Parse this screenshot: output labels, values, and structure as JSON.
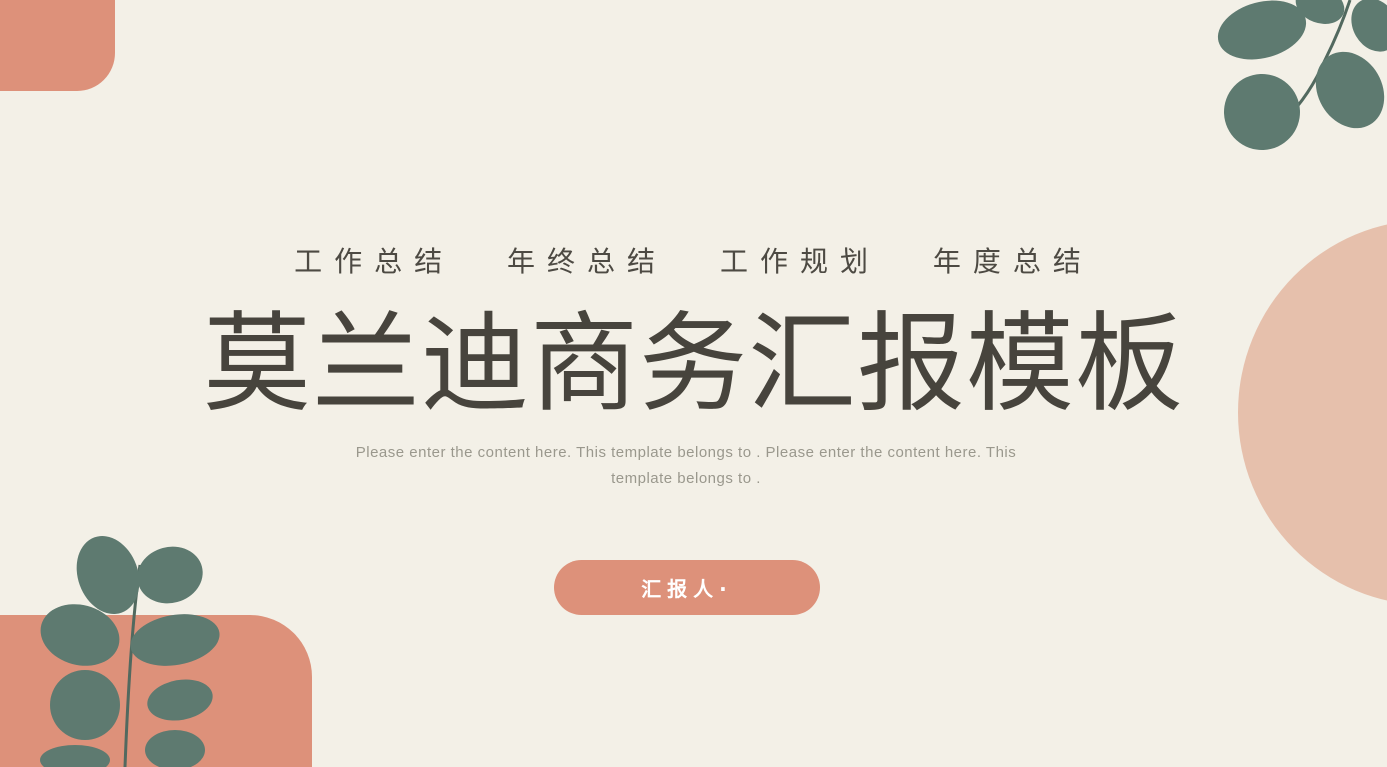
{
  "colors": {
    "background": "#f3f0e7",
    "accent": "#dd917a",
    "accent_light": "#e6c0ac",
    "leaf": "#5e7a70",
    "title_text": "#47443d",
    "subtitle_text": "#9a988d"
  },
  "tags": [
    "工作总结",
    "年终总结",
    "工作规划",
    "年度总结"
  ],
  "title": "莫兰迪商务汇报模板",
  "subtitle_line1": "Please enter the content here. This template belongs to  . Please enter the content here. This",
  "subtitle_line2": "template belongs to  .",
  "reporter_label": "汇报人·",
  "decorations": {
    "top_right_icon": "leaf-branch-icon",
    "bottom_left_icon": "leaf-sprig-icon"
  }
}
